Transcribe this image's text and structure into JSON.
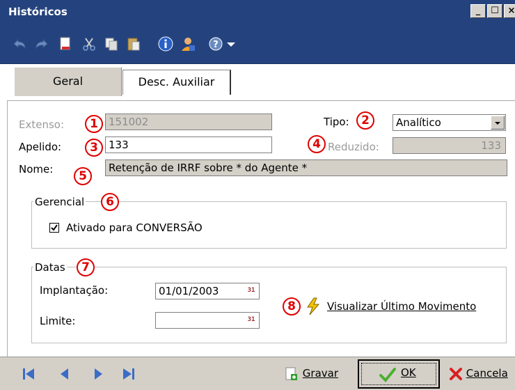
{
  "window": {
    "title": "Históricos"
  },
  "window_controls": {
    "minimize": "_",
    "maximize": "☐",
    "close": "×"
  },
  "tabs": [
    {
      "label": "Geral",
      "active": true
    },
    {
      "label": "Desc. Auxiliar",
      "active": false
    }
  ],
  "form": {
    "extenso_label": "Extenso:",
    "extenso_value": "151002",
    "apelido_label": "Apelido:",
    "apelido_value": "133",
    "nome_label": "Nome:",
    "nome_value": "Retenção de IRRF sobre * do Agente *",
    "tipo_label": "Tipo:",
    "tipo_value": "Analítico",
    "reduzido_label": "Reduzido:",
    "reduzido_value": "133"
  },
  "gerencial": {
    "title": "Gerencial",
    "checkbox_label": "Ativado para CONVERSÃO",
    "checked": true
  },
  "datas": {
    "title": "Datas",
    "implantacao_label": "Implantação:",
    "implantacao_value": "01/01/2003",
    "limite_label": "Limite:",
    "limite_value": "",
    "visualizar_label": "Visualizar Último Movimento"
  },
  "annotations": [
    "1",
    "2",
    "3",
    "4",
    "5",
    "6",
    "7",
    "8"
  ],
  "bottom": {
    "gravar_label": "Gravar",
    "ok_label": "OK",
    "cancelar_label": "Cancela"
  },
  "colors": {
    "titlebar": "#24437e",
    "panel": "#d4d0c8",
    "annotation_red": "#e00000"
  }
}
